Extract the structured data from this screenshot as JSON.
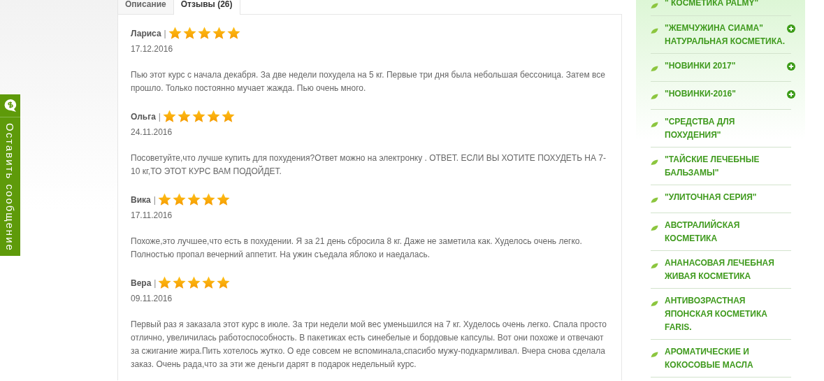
{
  "feedback_tab": {
    "label": "Оставить сообщение"
  },
  "tabs": [
    {
      "label": "Описание",
      "selected": false
    },
    {
      "label": "Отзывы (26)",
      "selected": true
    }
  ],
  "reviews": [
    {
      "name": "Лариса",
      "separator": "|",
      "stars": 5,
      "date": "17.12.2016",
      "text": "Пью этот курс с начала декабря. За две недели похудела на 5 кг. Первые три дня была небольшая бессоница. Затем все прошло. Только постоянно мучает жажда. Пью очень много."
    },
    {
      "name": "Ольга",
      "separator": "|",
      "stars": 5,
      "date": "24.11.2016",
      "text": "Посоветуйте,что лучше купить для похудения?Ответ можно на электронку . ОТВЕТ. ЕСЛИ ВЫ ХОТИТЕ ПОХУДЕТЬ НА 7-10 кг,ТО ЭТОТ КУРС ВАМ ПОДОЙДЕТ."
    },
    {
      "name": "Вика",
      "separator": "|",
      "stars": 5,
      "date": "17.11.2016",
      "text": "Похоже,это лучшее,что есть в похудении. Я за 21 день сбросила 8 кг. Даже не заметила как. Худелось очень легко. Полностью пропал вечерний аппетит. На ужин съедала яблоко и наедалась."
    },
    {
      "name": "Вера",
      "separator": "|",
      "stars": 5,
      "date": "09.11.2016",
      "text": "Первый раз я заказала этот курс в июле. За три недели мой вес уменьшился на 7 кг. Худелось очень легко. Спала просто отлично, увеличилась работоспособность. В пакетиках есть синебелые и бордовые капсулы. Вот они похоже и отвечают за сжигание жира.Пить хотелось жутко. О еде совсем не вспоминала,спасибо мужу-подкармливал. Вчера снова сделала заказ. Очень рада,что за эти же деньги дарят в подарок недельный курс."
    }
  ],
  "sidebar": {
    "items": [
      {
        "label": "\" КОСМЕТИКА PALMY\"",
        "expandable": false
      },
      {
        "label": "\"ЖЕМЧУЖИНА СИАМА\" НАТУРАЛЬНАЯ КОСМЕТИКА.",
        "expandable": true
      },
      {
        "label": "\"НОВИНКИ 2017\"",
        "expandable": true
      },
      {
        "label": "\"НОВИНКИ-2016\"",
        "expandable": true
      },
      {
        "label": "\"СРЕДСТВА ДЛЯ ПОХУДЕНИЯ\"",
        "expandable": false
      },
      {
        "label": "\"ТАЙСКИЕ ЛЕЧЕБНЫЕ БАЛЬЗАМЫ\"",
        "expandable": false
      },
      {
        "label": "\"УЛИТОЧНАЯ СЕРИЯ\"",
        "expandable": false
      },
      {
        "label": "АВСТРАЛИЙСКАЯ КОСМЕТИКА",
        "expandable": false
      },
      {
        "label": "АНАНАСОВАЯ ЛЕЧЕБНАЯ ЖИВАЯ КОСМЕТИКА",
        "expandable": false
      },
      {
        "label": "АНТИВОЗРАСТНАЯ ЯПОНСКАЯ КОСМЕТИКА FARIS.",
        "expandable": false
      },
      {
        "label": "АРОМАТИЧЕСКИЕ И КОКОСОВЫЕ МАСЛА",
        "expandable": false
      }
    ]
  }
}
